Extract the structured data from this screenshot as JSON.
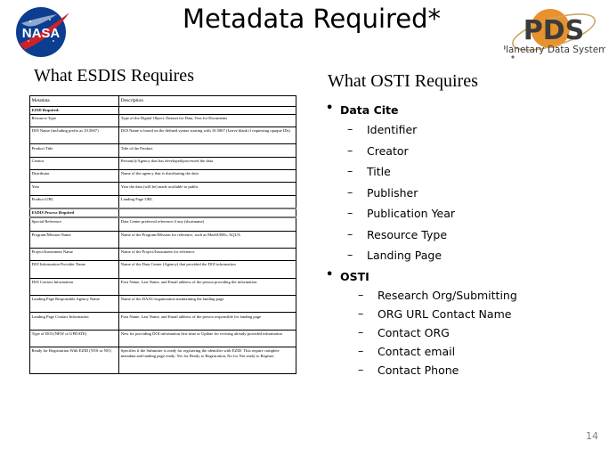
{
  "slide": {
    "title": "Metadata Required*",
    "page_number": "14"
  },
  "logos": {
    "nasa": {
      "name": "nasa-meatball-logo",
      "wordmark": "NASA",
      "circle_color": "#0b3d91",
      "swoosh_color": "#cc2229"
    },
    "pds": {
      "name": "pds-logo",
      "acronym": "PDS",
      "subtitle": "Planetary Data System",
      "planet_color": "#e8912d",
      "text_color": "#3b3b3b"
    }
  },
  "esdis": {
    "heading": "What ESDIS Requires",
    "table": {
      "columns": [
        "Metadata",
        "Description"
      ],
      "rows": [
        {
          "metadata": "EZID Required:",
          "description": "",
          "style": "section-plain"
        },
        {
          "metadata": "Resource Type",
          "description": "Type of the Digital Object, Dataset for Data, Text for Documents",
          "style": "normal"
        },
        {
          "metadata": "DOI Name (including prefix as 10.5067)",
          "description": "DOI Name is based on the defined syntax starting with 10.5067 (Leave blank if requesting opaque IDs)",
          "style": "tall2"
        },
        {
          "metadata": "Product Title",
          "description": "Title of the Product",
          "style": "normal"
        },
        {
          "metadata": "Creator",
          "description": "Person(s)/Agency that has developed/processed the data",
          "style": "normal"
        },
        {
          "metadata": "Distributor",
          "description": "Name of the agency that is distributing the data",
          "style": "normal"
        },
        {
          "metadata": "Year",
          "description": "Year the data (will be) made available to public",
          "style": "normal"
        },
        {
          "metadata": "Product URL",
          "description": "Landing Page URL",
          "style": "normal"
        },
        {
          "metadata": "ESDIS Process Required",
          "description": "",
          "style": "section"
        },
        {
          "metadata": "Special Reference",
          "description": "Data Center preferred reference if any (shortname)",
          "style": "normal"
        },
        {
          "metadata": "Program/Mission Name",
          "description": "Name of the Program/Mission for reference, such as MeaSUREs, AQUA",
          "style": "tall2"
        },
        {
          "metadata": "Project/Instrument Name",
          "description": "Name of the Project/Instrument for reference",
          "style": "normal"
        },
        {
          "metadata": "DOI Information Provider Name",
          "description": "Name of the Data Center (Agency) that provided the DOI information",
          "style": "tall2"
        },
        {
          "metadata": "DOI Contact Information",
          "description": "First Name, Last Name, and Email address of the person providing the information",
          "style": "tall2"
        },
        {
          "metadata": "Landing Page Responsible Agency Name",
          "description": "Name of the DAAC/organization maintaining the landing page",
          "style": "tall2"
        },
        {
          "metadata": "Landing Page Contact Information",
          "description": "First Name, Last Name, and Email address of the person responsible for landing page",
          "style": "tall2"
        },
        {
          "metadata": "Type of DOI (NEW or UPDATE)",
          "description": "New for providing DOI information first time or Update for revising already provided information",
          "style": "tall2"
        },
        {
          "metadata": "Ready for Registration With EZID (YES or NO)",
          "description": "Specifies if the Submitter is ready for registering the identifier with EZID. This require complete metadata and landing page ready: Yes for Ready to Registration, No for Not ready to Register",
          "style": "tall3"
        }
      ]
    }
  },
  "osti": {
    "heading": "What OSTI Requires",
    "groups": [
      {
        "label": "Data Cite",
        "items": [
          "Identifier",
          "Creator",
          "Title",
          "Publisher",
          "Publication Year",
          "Resource Type",
          "Landing Page"
        ]
      },
      {
        "label": "OSTI",
        "items": [
          "Research Org/Submitting",
          "ORG URL Contact Name",
          "Contact ORG",
          "Contact email",
          "Contact Phone"
        ]
      }
    ],
    "bullet_mark_level1": "•",
    "bullet_mark_level2": "–"
  }
}
